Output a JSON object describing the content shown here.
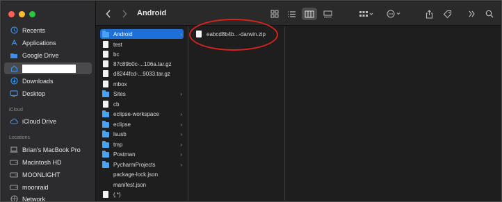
{
  "window": {
    "title": "Android"
  },
  "sidebar": {
    "items": [
      {
        "label": "Recents",
        "icon": "clock-icon"
      },
      {
        "label": "Applications",
        "icon": "applications-icon"
      },
      {
        "label": "Google Drive",
        "icon": "folder-icon"
      },
      {
        "label": "",
        "icon": "home-icon",
        "redacted": true
      },
      {
        "label": "Downloads",
        "icon": "download-icon"
      },
      {
        "label": "Desktop",
        "icon": "desktop-icon"
      }
    ],
    "icloud_header": "iCloud",
    "icloud_items": [
      {
        "label": "iCloud Drive",
        "icon": "cloud-icon"
      }
    ],
    "locations_header": "Locations",
    "locations_items": [
      {
        "label": "Brian's MacBook Pro",
        "icon": "laptop-icon"
      },
      {
        "label": "Macintosh HD",
        "icon": "disk-icon"
      },
      {
        "label": "MOONLIGHT",
        "icon": "disk-icon"
      },
      {
        "label": "moonraid",
        "icon": "disk-icon"
      },
      {
        "label": "Network",
        "icon": "network-icon"
      }
    ]
  },
  "column1": {
    "items": [
      {
        "name": "Android",
        "type": "folder",
        "selected": true,
        "chevron": true
      },
      {
        "name": "test",
        "type": "doc"
      },
      {
        "name": "bc",
        "type": "doc"
      },
      {
        "name": "87c89b0c-...106a.tar.gz",
        "type": "doc"
      },
      {
        "name": "d8244fcd-...9033.tar.gz",
        "type": "doc"
      },
      {
        "name": "mbox",
        "type": "doc"
      },
      {
        "name": "Sites",
        "type": "folder",
        "chevron": true
      },
      {
        "name": "cb",
        "type": "doc"
      },
      {
        "name": "eclipse-workspace",
        "type": "folder",
        "chevron": true
      },
      {
        "name": "eclipse",
        "type": "folder",
        "chevron": true
      },
      {
        "name": "lsusb",
        "type": "folder",
        "chevron": true
      },
      {
        "name": "tmp",
        "type": "folder",
        "chevron": true
      },
      {
        "name": "Postman",
        "type": "folder",
        "chevron": true
      },
      {
        "name": "PycharmProjects",
        "type": "folder",
        "chevron": true
      },
      {
        "name": "package-lock.json",
        "type": "none"
      },
      {
        "name": "manifest.json",
        "type": "none"
      },
      {
        "name": "(.*)",
        "type": "doc"
      }
    ]
  },
  "column2": {
    "items": [
      {
        "name": "eabcd8b4b...-darwin.zip",
        "type": "doc"
      }
    ]
  },
  "colors": {
    "accent": "#1f6fd8",
    "annotation": "#d8231f"
  }
}
